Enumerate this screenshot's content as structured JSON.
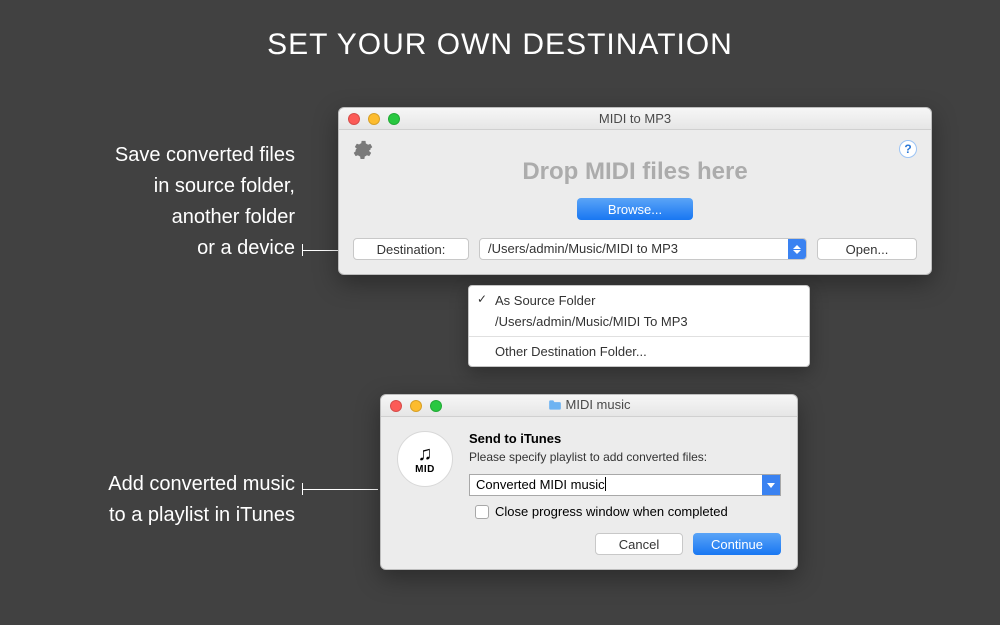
{
  "page": {
    "title": "SET YOUR OWN DESTINATION"
  },
  "caption1": {
    "line1": "Save converted files",
    "line2": "in source folder,",
    "line3": "another folder",
    "line4": "or a device"
  },
  "caption2": {
    "line1": "Add converted music",
    "line2": "to a playlist in iTunes"
  },
  "window1": {
    "title": "MIDI to MP3",
    "drop_text": "Drop MIDI files here",
    "browse_label": "Browse...",
    "destination_label": "Destination:",
    "destination_value": "/Users/admin/Music/MIDI to MP3",
    "open_label": "Open...",
    "help_label": "?"
  },
  "menu": {
    "item1": "As Source Folder",
    "item2": "/Users/admin/Music/MIDI To MP3",
    "item3": "Other Destination Folder..."
  },
  "window2": {
    "title": "MIDI music",
    "heading": "Send to iTunes",
    "subheading": "Please specify playlist to add converted files:",
    "playlist_value": "Converted MIDI music",
    "checkbox_label": "Close progress window when completed",
    "cancel_label": "Cancel",
    "continue_label": "Continue",
    "icon_text": "MID"
  }
}
